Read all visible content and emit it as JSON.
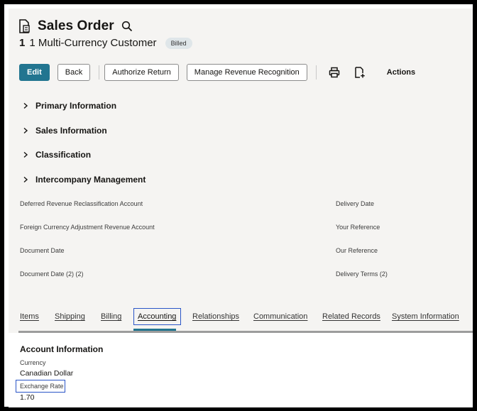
{
  "header": {
    "title": "Sales Order",
    "record_number": "1",
    "record_name": "1 Multi-Currency Customer",
    "status": "Billed"
  },
  "toolbar": {
    "edit": "Edit",
    "back": "Back",
    "authorize_return": "Authorize Return",
    "manage_revenue": "Manage Revenue Recognition",
    "actions": "Actions"
  },
  "sections": [
    "Primary Information",
    "Sales Information",
    "Classification",
    "Intercompany Management"
  ],
  "fields_left": [
    "Deferred Revenue Reclassification Account",
    "Foreign Currency Adjustment Revenue Account",
    "Document Date",
    "Document Date (2) (2)"
  ],
  "fields_right": [
    "Delivery Date",
    "Your Reference",
    "Our Reference",
    "Delivery Terms (2)"
  ],
  "tabs": [
    "Items",
    "Shipping",
    "Billing",
    "Accounting",
    "Relationships",
    "Communication",
    "Related Records",
    "System Information"
  ],
  "active_tab": "Accounting",
  "account_info": {
    "heading": "Account Information",
    "currency_label": "Currency",
    "currency_value": "Canadian Dollar",
    "rate_label": "Exchange Rate",
    "rate_value": "1.70"
  },
  "colors": {
    "primary": "#227590",
    "highlight_box": "#2a55c7"
  },
  "icons": [
    "document-icon",
    "search-icon",
    "print-icon",
    "new-document-icon",
    "chevron-right-icon"
  ]
}
